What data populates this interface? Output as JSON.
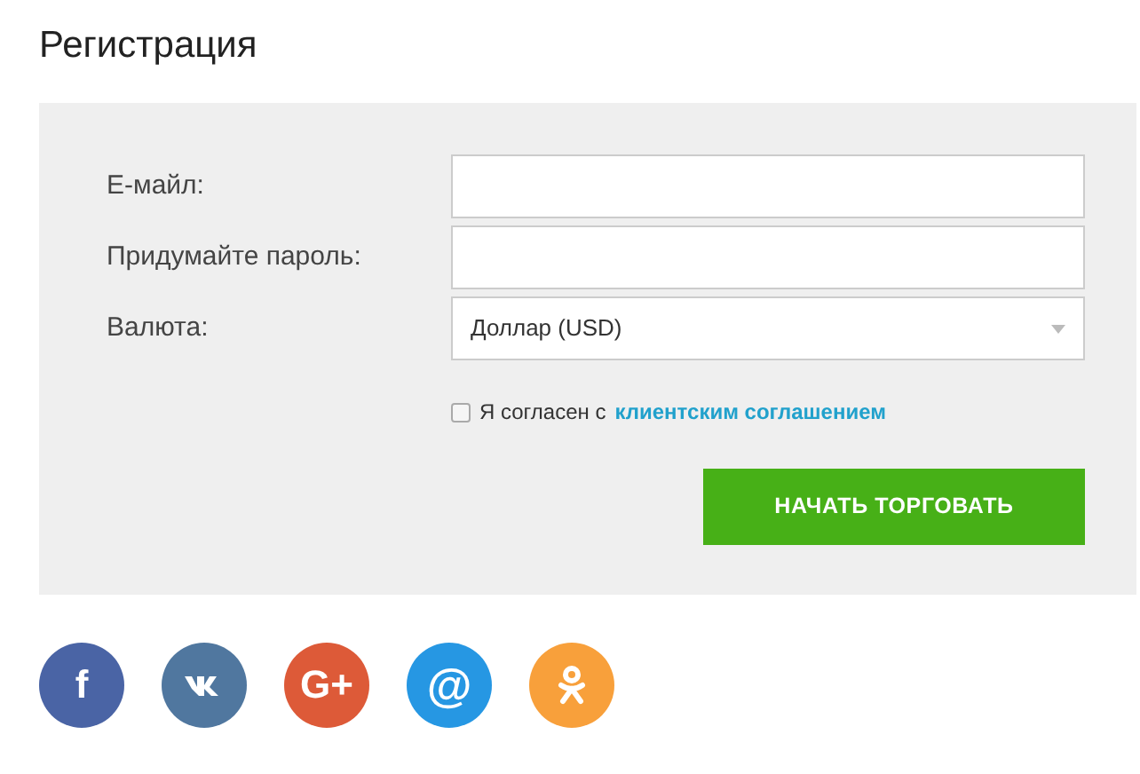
{
  "title": "Регистрация",
  "fields": [
    {
      "label": "Е-майл:",
      "kind": "text"
    },
    {
      "label": "Придумайте пароль:",
      "kind": "password"
    },
    {
      "label": "Валюта:",
      "kind": "select",
      "value": "Доллар (USD)"
    }
  ],
  "agreement": {
    "checked": false,
    "text": "Я согласен с",
    "link": "клиентским соглашением"
  },
  "submit": "НАЧАТЬ ТОРГОВАТЬ",
  "social": [
    {
      "kind": "facebook",
      "glyph": "f",
      "color": "#4a64a5"
    },
    {
      "kind": "vk",
      "color": "#50779f"
    },
    {
      "kind": "googleplus",
      "glyph": "G+",
      "color": "#dd5a38"
    },
    {
      "kind": "mail",
      "glyph": "@",
      "color": "#2697e3"
    },
    {
      "kind": "ok",
      "color": "#f8a03b"
    }
  ]
}
